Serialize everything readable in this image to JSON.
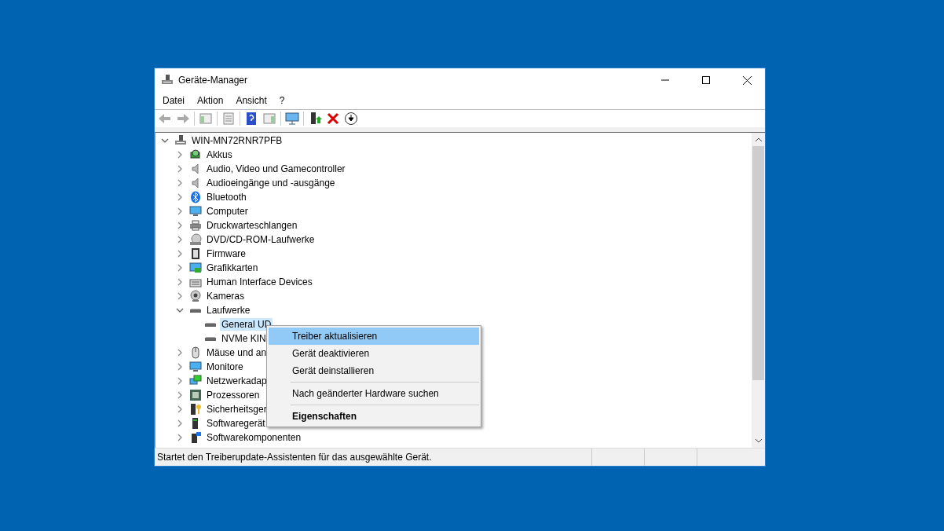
{
  "window": {
    "title": "Geräte-Manager"
  },
  "menu_bar": [
    "Datei",
    "Aktion",
    "Ansicht",
    "?"
  ],
  "tree": {
    "label": "WIN-MN72RNR7PFB",
    "expanded": true,
    "selected": false,
    "children": [
      {
        "label": "Akkus",
        "expanded": false,
        "selected": false
      },
      {
        "label": "Audio, Video und Gamecontroller",
        "expanded": false,
        "selected": false
      },
      {
        "label": "Audioeingänge und -ausgänge",
        "expanded": false,
        "selected": false
      },
      {
        "label": "Bluetooth",
        "expanded": false,
        "selected": false
      },
      {
        "label": "Computer",
        "expanded": false,
        "selected": false
      },
      {
        "label": "Druckwarteschlangen",
        "expanded": false,
        "selected": false
      },
      {
        "label": "DVD/CD-ROM-Laufwerke",
        "expanded": false,
        "selected": false
      },
      {
        "label": "Firmware",
        "expanded": false,
        "selected": false
      },
      {
        "label": "Grafikkarten",
        "expanded": false,
        "selected": false
      },
      {
        "label": "Human Interface Devices",
        "expanded": false,
        "selected": false
      },
      {
        "label": "Kameras",
        "expanded": false,
        "selected": false
      },
      {
        "label": "Laufwerke",
        "expanded": true,
        "selected": false,
        "children": [
          {
            "label": "General UD",
            "selected": true
          },
          {
            "label": "NVMe KIN",
            "selected": false
          }
        ]
      },
      {
        "label": "Mäuse und an",
        "expanded": false,
        "selected": false
      },
      {
        "label": "Monitore",
        "expanded": false,
        "selected": false
      },
      {
        "label": "Netzwerkadap",
        "expanded": false,
        "selected": false
      },
      {
        "label": "Prozessoren",
        "expanded": false,
        "selected": false
      },
      {
        "label": "Sicherheitsger",
        "expanded": false,
        "selected": false
      },
      {
        "label": "Softwaregerät",
        "expanded": false,
        "selected": false
      },
      {
        "label": "Softwarekomponenten",
        "expanded": false,
        "selected": false
      }
    ]
  },
  "context_menu": [
    {
      "kind": "item",
      "label": "Treiber aktualisieren",
      "selected": true,
      "default": false
    },
    {
      "kind": "item",
      "label": "Gerät deaktivieren",
      "selected": false,
      "default": false
    },
    {
      "kind": "item",
      "label": "Gerät deinstallieren",
      "selected": false,
      "default": false
    },
    {
      "kind": "separator"
    },
    {
      "kind": "item",
      "label": "Nach geänderter Hardware suchen",
      "selected": false,
      "default": false
    },
    {
      "kind": "separator"
    },
    {
      "kind": "item",
      "label": "Eigenschaften",
      "selected": false,
      "default": true
    }
  ],
  "status_bar": {
    "text": "Startet den Treiberupdate-Assistenten für das ausgewählte Gerät."
  }
}
